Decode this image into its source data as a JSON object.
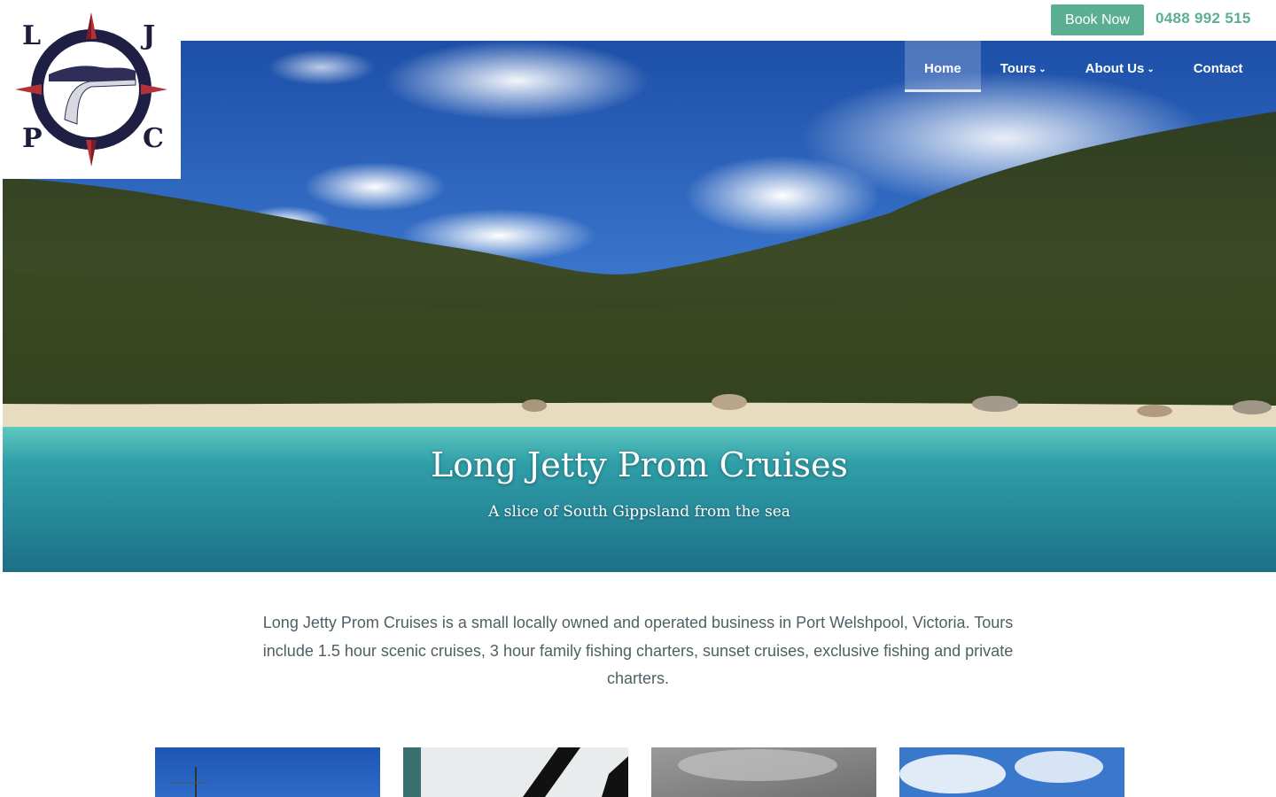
{
  "header": {
    "book_label": "Book Now",
    "phone": "0488 992 515",
    "accent_color": "#5aaf93"
  },
  "logo": {
    "letters": [
      "L",
      "J",
      "P",
      "C"
    ],
    "icon": "compass-jetty-logo"
  },
  "nav": {
    "items": [
      {
        "label": "Home",
        "active": true,
        "dropdown": false
      },
      {
        "label": "Tours",
        "active": false,
        "dropdown": true
      },
      {
        "label": "About Us",
        "active": false,
        "dropdown": true
      },
      {
        "label": "Contact",
        "active": false,
        "dropdown": false
      }
    ],
    "dropdown_icon": "chevron-down-icon"
  },
  "hero": {
    "title": "Long Jetty Prom Cruises",
    "subtitle": "A slice of South Gippsland from the sea"
  },
  "intro": {
    "text": "Long Jetty Prom Cruises is a small locally owned and operated business in Port Welshpool, Victoria. Tours include 1.5 hour scenic cruises, 3 hour family fishing charters, sunset cruises, exclusive fishing and private charters."
  },
  "cards": [
    {
      "image": "blue-sky-mast-photo"
    },
    {
      "image": "boat-cabin-window-photo"
    },
    {
      "image": "grey-cloudy-sky-photo"
    },
    {
      "image": "blue-sky-clouds-photo"
    }
  ]
}
